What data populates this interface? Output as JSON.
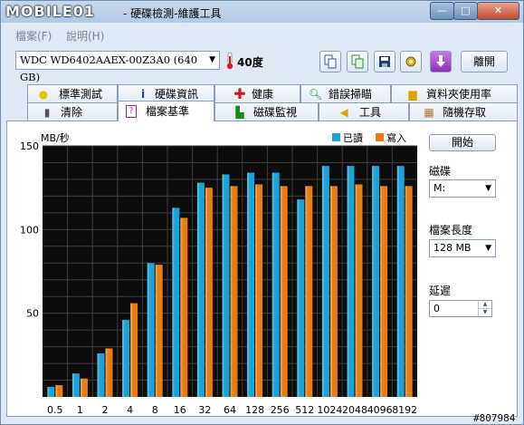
{
  "window": {
    "logo": "MOBILE01",
    "title": "- 硬碟檢測-維護工具",
    "controls": {
      "minimize": "—",
      "maximize": "□",
      "close": "✕"
    }
  },
  "menu": {
    "file": "檔案(F)",
    "help": "說明(H)"
  },
  "toolbar": {
    "drive": "WDC WD6402AAEX-00Z3A0 (640 GB)",
    "temperature": "40度",
    "icons": [
      "copy-icon",
      "copy-green-icon",
      "save-icon",
      "tools-icon",
      "download-icon"
    ],
    "exit_label": "離開"
  },
  "tabs_row1": [
    {
      "label": "標準測試",
      "icon": "lightbulb-icon"
    },
    {
      "label": "硬碟資訊",
      "icon": "info-icon"
    },
    {
      "label": "健康",
      "icon": "health-cross-icon"
    },
    {
      "label": "錯誤掃瞄",
      "icon": "magnifier-icon"
    },
    {
      "label": "資料夾使用率",
      "icon": "folder-icon"
    }
  ],
  "tabs_row2": [
    {
      "label": "清除",
      "icon": "trash-icon"
    },
    {
      "label": "檔案基準",
      "icon": "file-benchmark-icon",
      "active": true
    },
    {
      "label": "磁碟監視",
      "icon": "monitor-chart-icon"
    },
    {
      "label": "工具",
      "icon": "speaker-icon"
    },
    {
      "label": "隨機存取",
      "icon": "random-access-icon"
    }
  ],
  "side": {
    "start_label": "開始",
    "disk_label": "磁碟",
    "disk_value": "M:",
    "file_length_label": "檔案長度",
    "file_length_value": "128 MB",
    "delay_label": "延遲",
    "delay_value": "0"
  },
  "colors": {
    "read": "#1aa3d9",
    "write": "#e97c12",
    "chart_bg": "#0c0c0c",
    "grid": "#3c3c3c"
  },
  "chart_data": {
    "type": "bar",
    "ylabel": "MB/秒",
    "ylim": [
      0,
      150
    ],
    "yticks": [
      50,
      100,
      150
    ],
    "grid": true,
    "legend_position": "top-right",
    "categories": [
      "0.5",
      "1",
      "2",
      "4",
      "8",
      "16",
      "32",
      "64",
      "128",
      "256",
      "512",
      "1024",
      "2048",
      "4096",
      "8192"
    ],
    "series": [
      {
        "name": "已讀",
        "color": "#1aa3d9",
        "values": [
          6,
          14,
          26,
          46,
          80,
          113,
          128,
          133,
          134,
          134,
          118,
          138,
          138,
          138,
          138
        ]
      },
      {
        "name": "寫入",
        "color": "#e97c12",
        "values": [
          7,
          11,
          29,
          56,
          79,
          107,
          125,
          126,
          127,
          126,
          126,
          126,
          127,
          126,
          126
        ]
      }
    ]
  },
  "watermark": "#807984"
}
